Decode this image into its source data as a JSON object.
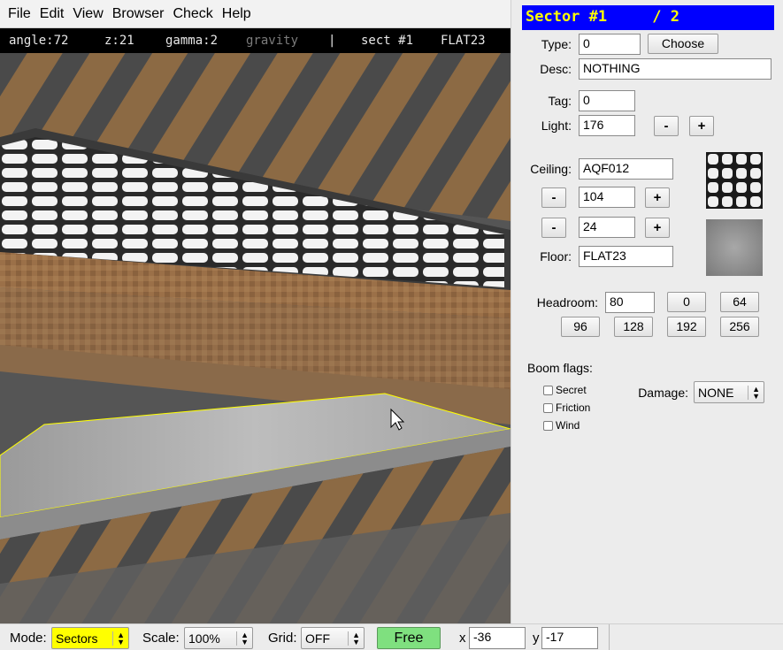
{
  "menu": [
    "File",
    "Edit",
    "View",
    "Browser",
    "Check",
    "Help"
  ],
  "info": {
    "angle": "angle:72",
    "z": "z:21",
    "gamma": "gamma:2",
    "gravity": "gravity",
    "sep": "|",
    "sect": "sect #1",
    "flat": "FLAT23"
  },
  "panel": {
    "header": "Sector #1     / 2",
    "type_label": "Type:",
    "type_value": "0",
    "choose_label": "Choose",
    "desc_label": "Desc:",
    "desc_value": "NOTHING",
    "tag_label": "Tag:",
    "tag_value": "0",
    "light_label": "Light:",
    "light_value": "176",
    "minus": "-",
    "plus": "+",
    "ceiling_label": "Ceiling:",
    "ceiling_tex": "AQF012",
    "ceiling_height": "104",
    "floor_height": "24",
    "floor_label": "Floor:",
    "floor_tex": "FLAT23",
    "headroom_label": "Headroom:",
    "headroom_value": "80",
    "headroom_presets": [
      "0",
      "64",
      "96",
      "128",
      "192",
      "256"
    ],
    "boom_label": "Boom flags:",
    "flags": [
      "Secret",
      "Friction",
      "Wind"
    ],
    "damage_label": "Damage:",
    "damage_value": "NONE"
  },
  "status": {
    "mode_label": "Mode:",
    "mode_value": "Sectors",
    "scale_label": "Scale:",
    "scale_value": "100%",
    "grid_label": "Grid:",
    "grid_value": "OFF",
    "free_label": "Free",
    "x_label": "x",
    "x_value": "-36",
    "y_label": "y",
    "y_value": "-17"
  },
  "colors": {
    "header_bg": "#0000ff",
    "header_fg": "#ffff00",
    "mode_bg": "#ffff00",
    "free_bg": "#7fe07f",
    "selection": "#ffff00"
  }
}
